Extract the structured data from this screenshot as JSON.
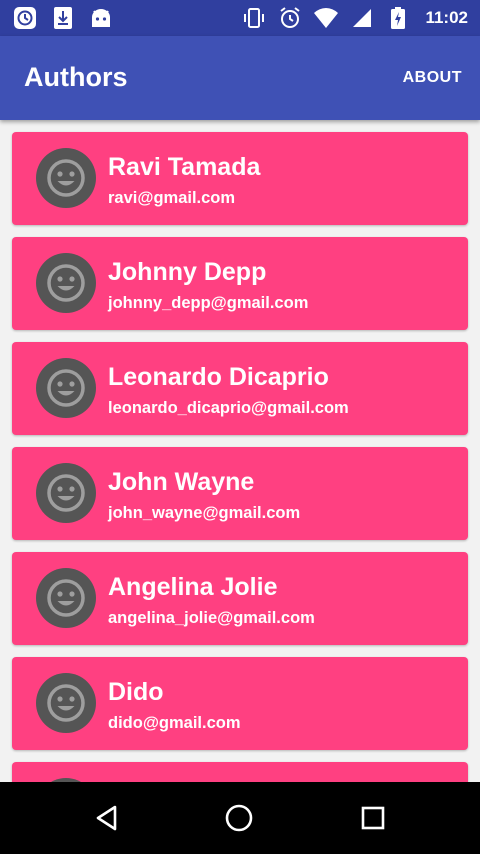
{
  "status_bar": {
    "time": "11:02",
    "left_icons": [
      "history-icon",
      "download-icon",
      "android-icon"
    ],
    "right_icons": [
      "vibrate-icon",
      "alarm-icon",
      "wifi-icon",
      "signal-icon",
      "battery-charging-icon"
    ]
  },
  "app_bar": {
    "title": "Authors",
    "action_label": "ABOUT",
    "color": "#3f51b5"
  },
  "authors": [
    {
      "name": "Ravi Tamada",
      "email": "ravi@gmail.com"
    },
    {
      "name": "Johnny Depp",
      "email": "johnny_depp@gmail.com"
    },
    {
      "name": "Leonardo Dicaprio",
      "email": "leonardo_dicaprio@gmail.com"
    },
    {
      "name": "John Wayne",
      "email": "john_wayne@gmail.com"
    },
    {
      "name": "Angelina Jolie",
      "email": "angelina_jolie@gmail.com"
    },
    {
      "name": "Dido",
      "email": "dido@gmail.com"
    }
  ],
  "card_color": "#ff4081",
  "avatar_icon": "smiley-face-icon",
  "nav_bar": {
    "icons": [
      "back-icon",
      "home-icon",
      "recents-icon"
    ]
  }
}
